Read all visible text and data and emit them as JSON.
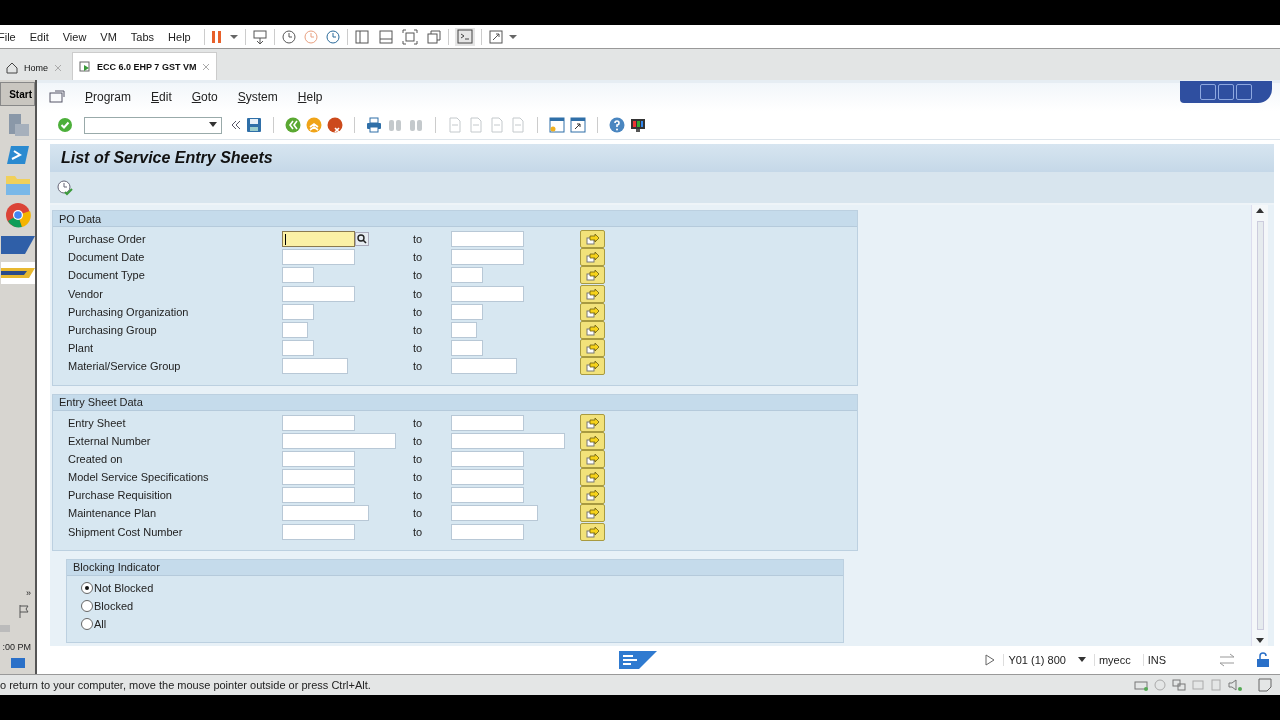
{
  "vm_menu": [
    "File",
    "Edit",
    "View",
    "VM",
    "Tabs",
    "Help"
  ],
  "vm_tabs": [
    {
      "label": "Home",
      "selected": false
    },
    {
      "label": "ECC 6.0 EHP 7 GST VM",
      "selected": true
    }
  ],
  "taskbar": {
    "start": "Start",
    "expand": "»",
    "clock": ":00 PM"
  },
  "sap_menu": [
    "Program",
    "Edit",
    "Goto",
    "System",
    "Help"
  ],
  "title": "List of Service Entry Sheets",
  "groups": [
    {
      "title": "PO Data",
      "fields": [
        {
          "label": "Purchase Order",
          "to": "to",
          "focused": true
        },
        {
          "label": "Document Date",
          "to": "to",
          "focused": false
        },
        {
          "label": "Document Type",
          "to": "to",
          "focused": false
        },
        {
          "label": "Vendor",
          "to": "to",
          "focused": false
        },
        {
          "label": "Purchasing Organization",
          "to": "to",
          "focused": false
        },
        {
          "label": "Purchasing Group",
          "to": "to",
          "focused": false
        },
        {
          "label": "Plant",
          "to": "to",
          "focused": false
        },
        {
          "label": "Material/Service Group",
          "to": "to",
          "focused": false
        }
      ]
    },
    {
      "title": "Entry Sheet Data",
      "fields": [
        {
          "label": "Entry Sheet",
          "to": "to",
          "focused": false
        },
        {
          "label": "External Number",
          "to": "to",
          "focused": false
        },
        {
          "label": "Created on",
          "to": "to",
          "focused": false
        },
        {
          "label": "Model Service Specifications",
          "to": "to",
          "focused": false
        },
        {
          "label": "Purchase Requisition",
          "to": "to",
          "focused": false
        },
        {
          "label": "Maintenance Plan",
          "to": "to",
          "focused": false
        },
        {
          "label": "Shipment Cost Number",
          "to": "to",
          "focused": false
        }
      ]
    }
  ],
  "blocking": {
    "title": "Blocking Indicator",
    "options": [
      {
        "label": "Not Blocked",
        "selected": true
      },
      {
        "label": "Blocked",
        "selected": false
      },
      {
        "label": "All",
        "selected": false
      }
    ]
  },
  "status": {
    "system": "Y01 (1) 800",
    "user": "myecc",
    "mode": "INS"
  },
  "vm_status": "o return to your computer, move the mouse pointer outside or press Ctrl+Alt."
}
